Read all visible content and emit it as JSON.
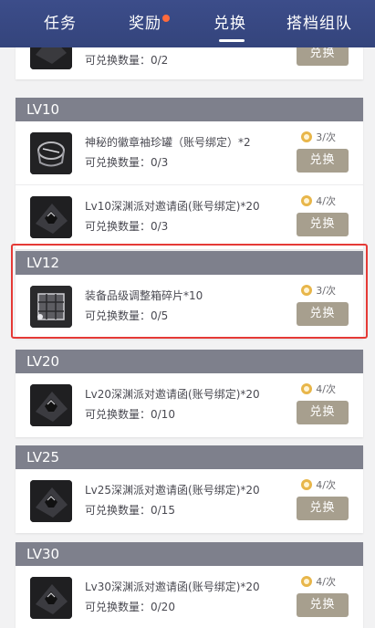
{
  "tabs": [
    {
      "label": "任务"
    },
    {
      "label": "奖励"
    },
    {
      "label": "兑换"
    },
    {
      "label": "搭档组队"
    }
  ],
  "partial_item": {
    "qty_label": "可兑换数量：0/2",
    "button_label": "兑换"
  },
  "levels": [
    {
      "header": "LV10",
      "items": [
        {
          "name": "神秘的徽章袖珍罐（账号绑定）*2",
          "qty_label": "可兑换数量：0/3",
          "limit": "3/次",
          "button_label": "兑换",
          "icon": "jar-icon"
        },
        {
          "name": "Lv10深渊派对邀请函(账号绑定)*20",
          "qty_label": "可兑换数量：0/3",
          "limit": "4/次",
          "button_label": "兑换",
          "icon": "invitation-icon"
        }
      ]
    },
    {
      "header": "LV12",
      "items": [
        {
          "name": "装备品级调整箱碎片*10",
          "qty_label": "可兑换数量：0/5",
          "limit": "3/次",
          "button_label": "兑换",
          "icon": "box-fragment-icon"
        }
      ]
    },
    {
      "header": "LV20",
      "items": [
        {
          "name": "Lv20深渊派对邀请函(账号绑定)*20",
          "qty_label": "可兑换数量：0/10",
          "limit": "4/次",
          "button_label": "兑换",
          "icon": "invitation-icon"
        }
      ]
    },
    {
      "header": "LV25",
      "items": [
        {
          "name": "Lv25深渊派对邀请函(账号绑定)*20",
          "qty_label": "可兑换数量：0/15",
          "limit": "4/次",
          "button_label": "兑换",
          "icon": "invitation-icon"
        }
      ]
    },
    {
      "header": "LV30",
      "items": [
        {
          "name": "Lv30深渊派对邀请函(账号绑定)*20",
          "qty_label": "可兑换数量：0/20",
          "limit": "4/次",
          "button_label": "兑换",
          "icon": "invitation-icon"
        }
      ]
    }
  ],
  "colors": {
    "tabbar": "#3c4d8a",
    "badge_dot": "#ff6a3c",
    "level_header": "#7e808c",
    "exchange_button": "#a79f8e",
    "highlight_box": "#e53a36"
  }
}
